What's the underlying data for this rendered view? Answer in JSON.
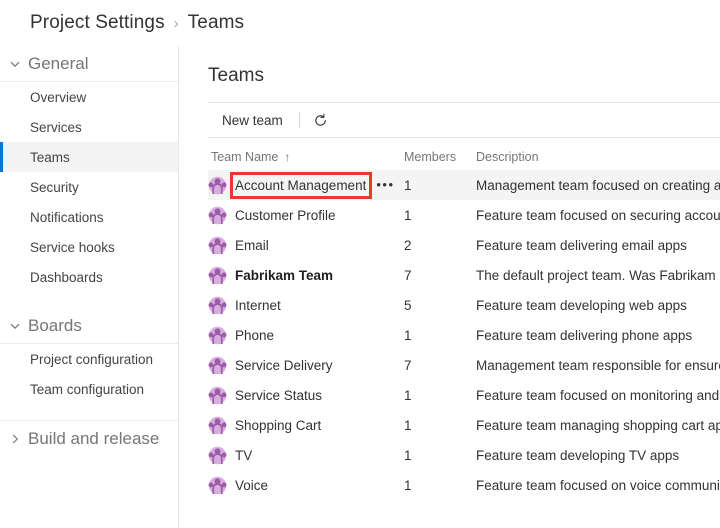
{
  "breadcrumb": {
    "items": [
      "Project Settings",
      "Teams"
    ],
    "separator": "›"
  },
  "sidebar": {
    "groups": [
      {
        "label": "General",
        "icon": "chevron-down-icon",
        "expanded": true,
        "items": [
          {
            "label": "Overview",
            "selected": false
          },
          {
            "label": "Services",
            "selected": false
          },
          {
            "label": "Teams",
            "selected": true
          },
          {
            "label": "Security",
            "selected": false
          },
          {
            "label": "Notifications",
            "selected": false
          },
          {
            "label": "Service hooks",
            "selected": false
          },
          {
            "label": "Dashboards",
            "selected": false
          }
        ]
      },
      {
        "label": "Boards",
        "icon": "chevron-down-icon",
        "expanded": true,
        "items": [
          {
            "label": "Project configuration",
            "selected": false
          },
          {
            "label": "Team configuration",
            "selected": false
          }
        ]
      },
      {
        "label": "Build and release",
        "icon": "chevron-right-icon",
        "expanded": false,
        "items": []
      }
    ]
  },
  "main": {
    "title": "Teams",
    "toolbar": {
      "new_team_label": "New team",
      "refresh_icon": "refresh-icon"
    },
    "table": {
      "columns": [
        {
          "label": "Team Name",
          "sort": "↑"
        },
        {
          "label": "Members",
          "sort": ""
        },
        {
          "label": "Description",
          "sort": ""
        }
      ],
      "row_menu_glyph": "•••",
      "rows": [
        {
          "name": "Account Management",
          "members": "1",
          "description": "Management team focused on creating an",
          "bold": false,
          "hovered": true,
          "menu": true
        },
        {
          "name": "Customer Profile",
          "members": "1",
          "description": "Feature team focused on securing account",
          "bold": false,
          "hovered": false,
          "menu": false
        },
        {
          "name": "Email",
          "members": "2",
          "description": "Feature team delivering email apps",
          "bold": false,
          "hovered": false,
          "menu": false
        },
        {
          "name": "Fabrikam Team",
          "members": "7",
          "description": "The default project team. Was Fabrikam Fi",
          "bold": true,
          "hovered": false,
          "menu": false
        },
        {
          "name": "Internet",
          "members": "5",
          "description": "Feature team developing web apps",
          "bold": false,
          "hovered": false,
          "menu": false
        },
        {
          "name": "Phone",
          "members": "1",
          "description": "Feature team delivering phone apps",
          "bold": false,
          "hovered": false,
          "menu": false
        },
        {
          "name": "Service Delivery",
          "members": "7",
          "description": "Management team responsible for ensure",
          "bold": false,
          "hovered": false,
          "menu": false
        },
        {
          "name": "Service Status",
          "members": "1",
          "description": "Feature team focused on monitoring and ",
          "bold": false,
          "hovered": false,
          "menu": false
        },
        {
          "name": "Shopping Cart",
          "members": "1",
          "description": "Feature team managing shopping cart app",
          "bold": false,
          "hovered": false,
          "menu": false
        },
        {
          "name": "TV",
          "members": "1",
          "description": "Feature team developing TV apps",
          "bold": false,
          "hovered": false,
          "menu": false
        },
        {
          "name": "Voice",
          "members": "1",
          "description": "Feature team focused on voice communic",
          "bold": false,
          "hovered": false,
          "menu": false
        }
      ]
    }
  },
  "annotation": {
    "target": "Account Management",
    "color": "#e8392a"
  },
  "colors": {
    "accent": "#0078d4",
    "avatar_fill": "#d7aedd",
    "avatar_stroke": "#9b5ba8",
    "highlight_row": "#f4f4f4",
    "text": "#333333",
    "muted_text": "#767676"
  }
}
